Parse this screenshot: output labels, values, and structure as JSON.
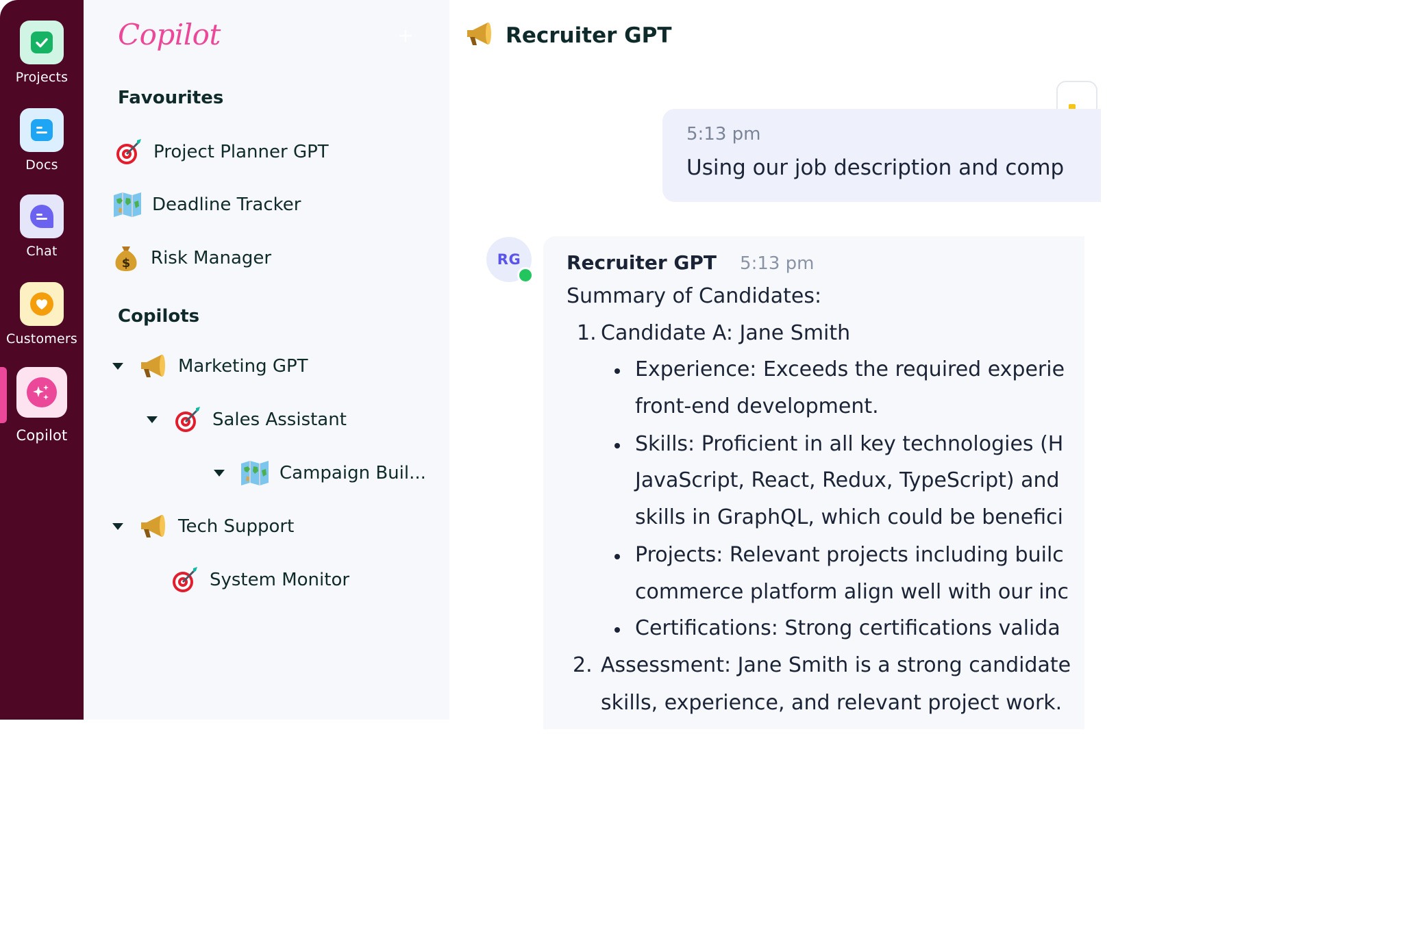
{
  "rail": {
    "items": [
      {
        "label": "Projects",
        "icon": "check-square-icon",
        "tile_color": "#d1f5e4",
        "accent": "#16b364"
      },
      {
        "label": "Docs",
        "icon": "doc-lines-icon",
        "tile_color": "#dcefff",
        "accent": "#1ea5f3"
      },
      {
        "label": "Chat",
        "icon": "chat-bubble-icon",
        "tile_color": "#e6e6fb",
        "accent": "#6b63f0"
      },
      {
        "label": "Customers",
        "icon": "heart-icon",
        "tile_color": "#fdf0c2",
        "accent": "#f59e0b"
      },
      {
        "label": "Copilot",
        "icon": "sparkles-icon",
        "tile_color": "#fde3f0",
        "accent": "#ec4899"
      }
    ],
    "active": "Copilot",
    "background": "#4e0725"
  },
  "sidebar": {
    "brand": "Copilot",
    "new_button_icon": "plus-icon",
    "favourites_title": "Favourites",
    "favourites": [
      {
        "label": "Project Planner GPT",
        "icon": "target-dart-icon"
      },
      {
        "label": "Deadline Tracker",
        "icon": "world-map-icon"
      },
      {
        "label": "Risk Manager",
        "icon": "money-bag-icon"
      }
    ],
    "copilots_title": "Copilots",
    "copilots": [
      {
        "label": "Marketing GPT",
        "icon": "megaphone-icon",
        "expanded": true
      },
      {
        "label": "Sales Assistant",
        "icon": "target-dart-icon",
        "expanded": true
      },
      {
        "label": "Campaign Buil...",
        "icon": "world-map-icon",
        "expanded": true
      },
      {
        "label": "Tech Support",
        "icon": "megaphone-icon",
        "expanded": true
      },
      {
        "label": "System Monitor",
        "icon": "target-dart-icon",
        "expanded": false
      }
    ]
  },
  "main": {
    "title": "Recruiter GPT",
    "title_icon": "megaphone-icon",
    "user_message": {
      "time": "5:13 pm",
      "text": "Using our job description and comp"
    },
    "bot_message": {
      "avatar": "RG",
      "status": "online",
      "author": "Recruiter GPT",
      "time": "5:13 pm",
      "intro": "Summary of Candidates:",
      "item1_number": "1.",
      "item1_title": "Candidate A: Jane Smith",
      "bullet1_line1": "Experience: Exceeds the required experie",
      "bullet1_line2": "front-end development.",
      "bullet2_line1": "Skills: Proficient in all key technologies (H",
      "bullet2_line2": "JavaScript, React, Redux, TypeScript) and",
      "bullet2_line3": "skills in GraphQL, which could be benefici",
      "bullet3_line1": "Projects: Relevant projects including builc",
      "bullet3_line2": "commerce platform align well with our inc",
      "bullet4_line1": "Certifications: Strong certifications valida",
      "item2_number": "2.",
      "item2_line1": "Assessment: Jane Smith is a strong candidate",
      "item2_line2": "skills, experience, and relevant project work."
    }
  },
  "colors": {
    "accent_pink": "#ec4899",
    "text_dark": "#0f2a2a",
    "online_green": "#22c55e",
    "user_bubble": "#eef1fc"
  }
}
